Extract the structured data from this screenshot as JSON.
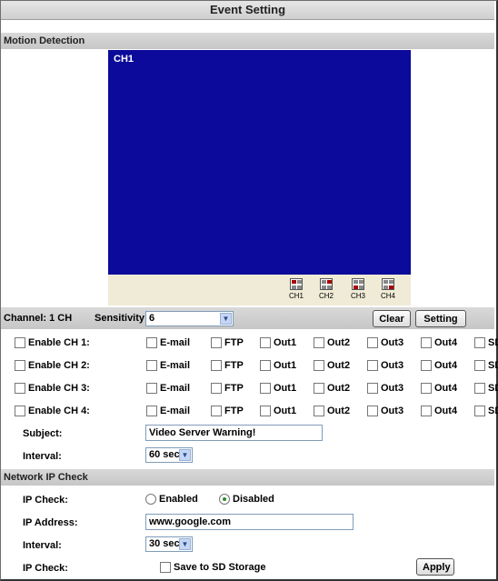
{
  "page_title": "Event Setting",
  "motion": {
    "section_title": "Motion Detection",
    "preview_label": "CH1",
    "channel_buttons": [
      "CH1",
      "CH2",
      "CH3",
      "CH4"
    ],
    "channel_label": "Channel: 1 CH",
    "sensitivity_label": "Sensitivity:",
    "sensitivity_value": "6",
    "clear_label": "Clear",
    "setting_label": "Setting",
    "channels": [
      {
        "label": "Enable CH 1:"
      },
      {
        "label": "Enable CH 2:"
      },
      {
        "label": "Enable CH 3:"
      },
      {
        "label": "Enable CH 4:"
      }
    ],
    "actions": [
      "E-mail",
      "FTP",
      "Out1",
      "Out2",
      "Out3",
      "Out4",
      "SD"
    ],
    "subject_label": "Subject:",
    "subject_value": "Video Server  Warning!",
    "interval_label": "Interval:",
    "interval_value": "60 sec"
  },
  "network": {
    "section_title": "Network IP Check",
    "ip_check_label": "IP Check:",
    "enabled_label": "Enabled",
    "disabled_label": "Disabled",
    "selected": "Disabled",
    "ip_address_label": "IP Address:",
    "ip_address_value": "www.google.com",
    "interval_label": "Interval:",
    "interval_value": "30 sec",
    "ip_check2_label": "IP Check:",
    "save_sd_label": "Save to SD Storage",
    "apply_label": "Apply"
  }
}
